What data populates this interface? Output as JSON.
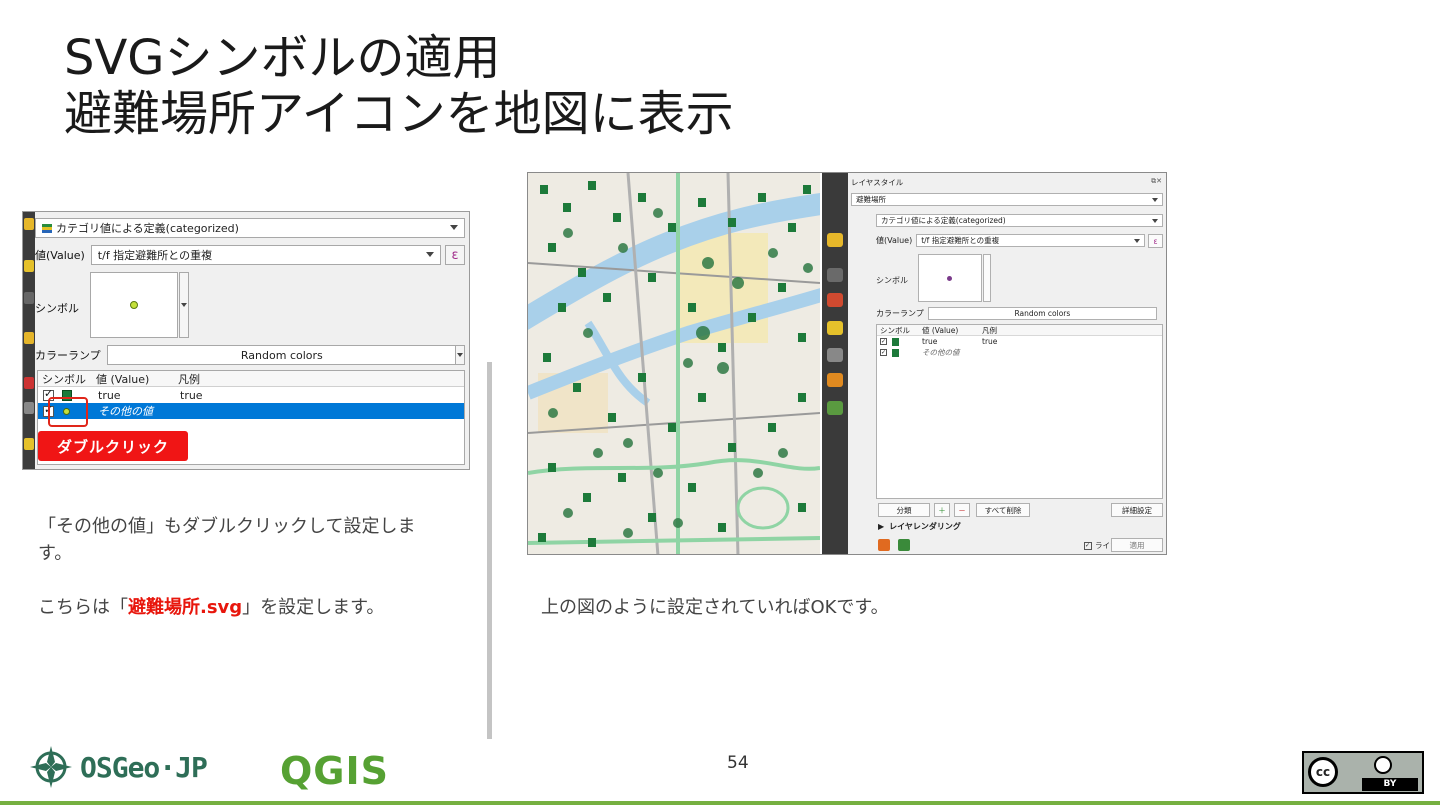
{
  "title": {
    "line1": "SVGシンボルの適用",
    "line2": "避難場所アイコンを地図に表示"
  },
  "left_panel": {
    "renderer": "カテゴリ値による定義(categorized)",
    "value_label": "値(Value)",
    "value_field": "t/f 指定避難所との重複",
    "expression_btn": "ε",
    "symbol_label": "シンボル",
    "color_ramp_label": "カラーランプ",
    "color_ramp_value": "Random colors",
    "columns": [
      "シンボル",
      "値 (Value)",
      "凡例"
    ],
    "rows": [
      {
        "value": "true",
        "legend": "true"
      },
      {
        "value": "その他の値",
        "legend": ""
      }
    ],
    "callout": "ダブルクリック"
  },
  "left_text": {
    "p1": "「その他の値」もダブルクリックして設定します。",
    "p2_prefix": "こちらは「",
    "p2_highlight": "避難場所.svg",
    "p2_suffix": "」を設定します。"
  },
  "right_panel": {
    "title": "レイヤスタイル",
    "layer": "避難場所",
    "renderer": "カテゴリ値による定義(categorized)",
    "value_label": "値(Value)",
    "value_field": "t/f 指定避難所との重複",
    "expression_btn": "ε",
    "symbol_label": "シンボル",
    "color_ramp_label": "カラーランプ",
    "color_ramp_value": "Random colors",
    "columns": [
      "シンボル",
      "値 (Value)",
      "凡例"
    ],
    "rows": [
      {
        "value": "true",
        "legend": "true"
      },
      {
        "value": "その他の値",
        "legend": ""
      }
    ],
    "classify_btn": "分類",
    "delete_all_btn": "すべて削除",
    "advanced_btn": "詳細設定",
    "layer_rendering": "レイヤレンダリング",
    "live_update": "ライブ更新",
    "apply_btn": "適用"
  },
  "right_text": "上の図のように設定されていればOKです。",
  "page_number": "54",
  "footer": {
    "osgeo": "OSGeo·JP",
    "qgis": "QGIS",
    "cc": "cc",
    "by": "BY"
  },
  "colors": {
    "accent_red": "#e8160c",
    "selection_blue": "#0078d7",
    "footer_green": "#76b041",
    "marker_green": "#1d7a3a"
  }
}
